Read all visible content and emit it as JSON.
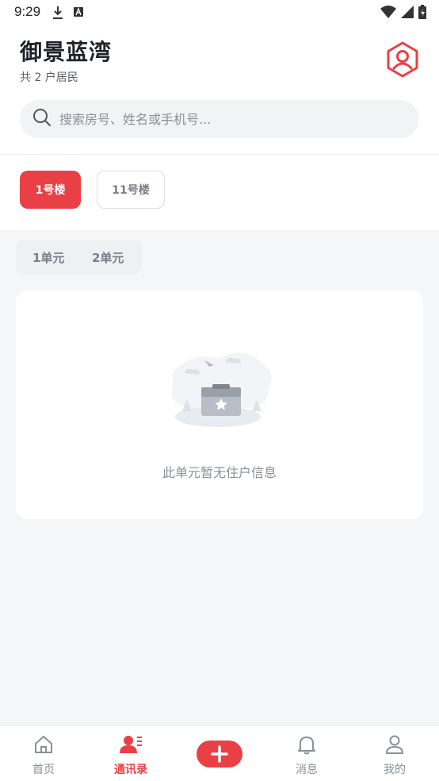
{
  "status_bar": {
    "time": "9:29"
  },
  "header": {
    "title": "御景蓝湾",
    "subtitle": "共 2 户居民"
  },
  "search": {
    "placeholder": "搜索房号、姓名或手机号..."
  },
  "buildings": [
    {
      "label": "1号楼",
      "active": true
    },
    {
      "label": "11号楼",
      "active": false
    }
  ],
  "units": [
    {
      "label": "1单元"
    },
    {
      "label": "2单元"
    }
  ],
  "empty_state": {
    "message": "此单元暂无住户信息"
  },
  "bottom_nav": [
    {
      "label": "首页",
      "icon": "home-icon",
      "active": false
    },
    {
      "label": "通讯录",
      "icon": "contacts-icon",
      "active": true
    },
    {
      "label": "",
      "icon": "plus-icon",
      "active": false
    },
    {
      "label": "消息",
      "icon": "bell-icon",
      "active": false
    },
    {
      "label": "我的",
      "icon": "user-icon",
      "active": false
    }
  ],
  "colors": {
    "accent": "#e94045",
    "background": "#f5f6f8",
    "muted_text": "#8a8f99"
  }
}
